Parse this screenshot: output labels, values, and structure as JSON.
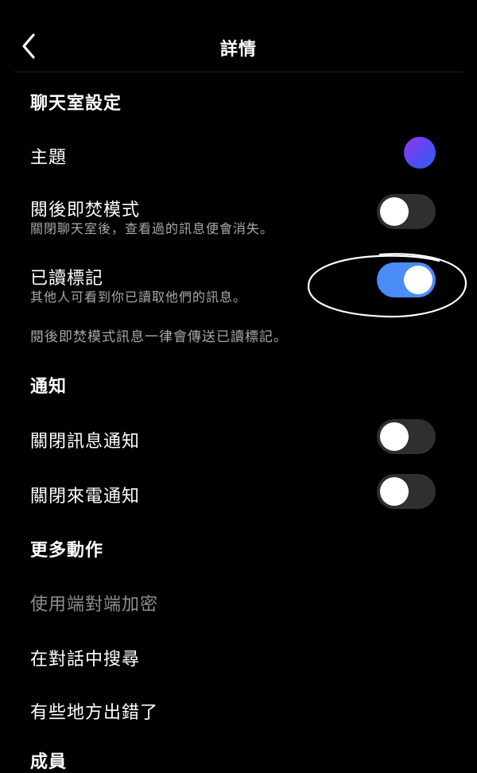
{
  "header": {
    "title": "詳情",
    "back_icon": "chevron-left-icon"
  },
  "chat_settings": {
    "title": "聊天室設定",
    "theme": {
      "label": "主題",
      "swatch_colors": [
        "#8b3cf0",
        "#2a63f2"
      ]
    },
    "vanish_mode": {
      "label": "閱後即焚模式",
      "subtitle": "關閉聊天室後，查看過的訊息便會消失。",
      "enabled": false
    },
    "read_receipts": {
      "label": "已讀標記",
      "subtitle": "其他人可看到你已讀取他們的訊息。",
      "enabled": true
    },
    "note": "閱後即焚模式訊息一律會傳送已讀標記。"
  },
  "notifications": {
    "title": "通知",
    "mute_messages": {
      "label": "關閉訊息通知",
      "enabled": false
    },
    "mute_calls": {
      "label": "關閉來電通知",
      "enabled": false
    }
  },
  "more_actions": {
    "title": "更多動作",
    "items": [
      {
        "label": "使用端對端加密",
        "disabled": true
      },
      {
        "label": "在對話中搜尋",
        "disabled": false
      },
      {
        "label": "有些地方出錯了",
        "disabled": false
      }
    ],
    "next_section_partial": "成員"
  },
  "colors": {
    "background": "#000000",
    "toggle_on": "#4a8df7",
    "toggle_off": "#2f2f2f",
    "subtext": "#a8a8a8"
  }
}
